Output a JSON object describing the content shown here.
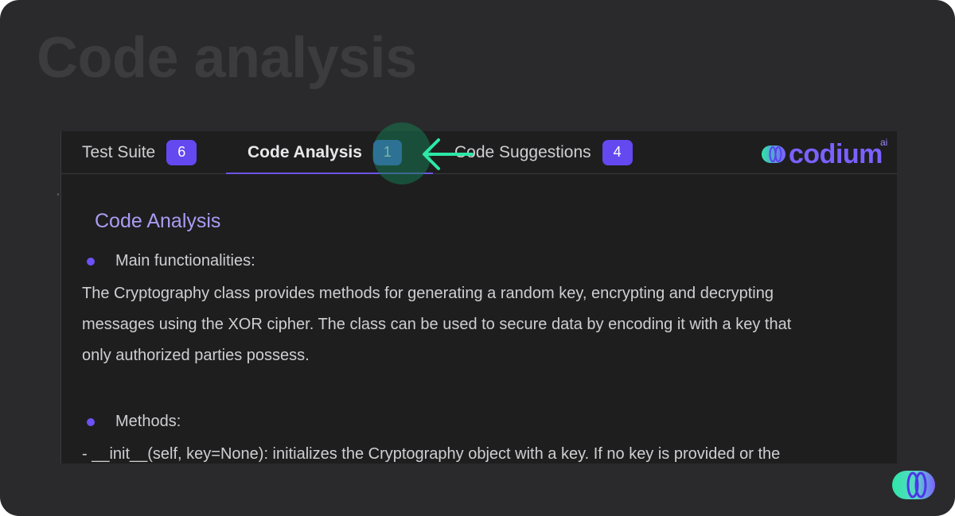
{
  "page": {
    "title": "Code analysis"
  },
  "tabs": [
    {
      "label": "Test Suite",
      "count": "6"
    },
    {
      "label": "Code Analysis",
      "count": "1",
      "active": true
    },
    {
      "label": "Code Suggestions",
      "count": "4"
    }
  ],
  "brand": {
    "name": "codium",
    "suffix": "ai",
    "color": "#7b61ff"
  },
  "analysis": {
    "heading": "Code Analysis",
    "bullet1": "Main functionalities:",
    "para1_line1": "The Cryptography class provides methods for generating a random key, encrypting and decrypting",
    "para1_line2": "messages using the XOR cipher. The class can be used to secure data by encoding it with a key that",
    "para1_line3": "only authorized parties possess.",
    "bullet2": "Methods:",
    "para2_line1": "- __init__(self, key=None): initializes the Cryptography object with a key. If no key is provided or the"
  },
  "colors": {
    "background": "#2a2a2c",
    "panel": "#1e1e1f",
    "accent": "#6448f0",
    "highlight": "#1e8a5a",
    "arrow": "#2ee6a6",
    "heading": "#a99cf2"
  },
  "icons": {
    "arrow": "arrow-left-icon",
    "logo": "codium-logo-icon",
    "corner": "codium-mark-icon",
    "bullet": "bullet-dot-icon"
  }
}
